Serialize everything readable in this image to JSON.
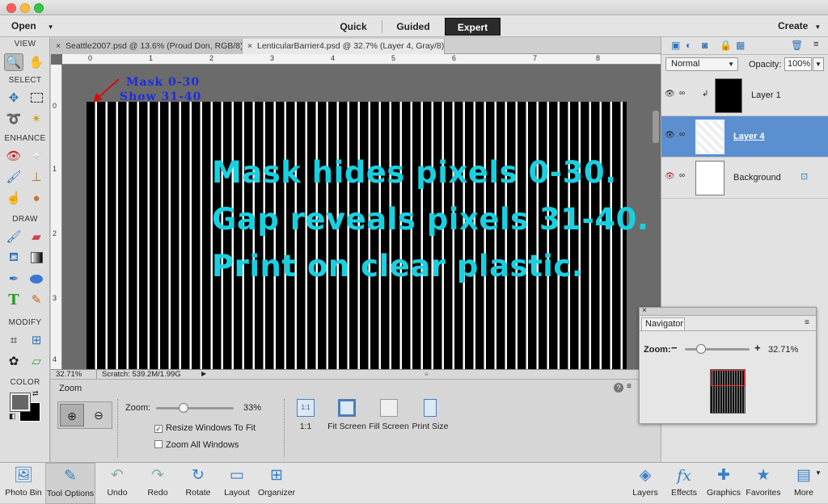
{
  "menu": {
    "open": "Open",
    "create": "Create"
  },
  "modes": [
    {
      "label": "Quick"
    },
    {
      "label": "Guided"
    },
    {
      "label": "Expert"
    }
  ],
  "tools": {
    "sections": {
      "view": "VIEW",
      "select": "SELECT",
      "enhance": "ENHANCE",
      "draw": "DRAW",
      "modify": "MODIFY",
      "color": "COLOR"
    }
  },
  "tabs": [
    {
      "label": "Seattle2007.psd @ 13.6% (Proud Don, RGB/8) *"
    },
    {
      "label": "LenticularBarrier4.psd @ 32.7% (Layer 4, Gray/8)"
    }
  ],
  "ruler": {
    "top": [
      "0",
      "1",
      "2",
      "3",
      "4",
      "5",
      "6",
      "7",
      "8"
    ],
    "left": [
      "0",
      "1",
      "2",
      "3",
      "4"
    ]
  },
  "canvas": {
    "annotation1": "Mask 0-30",
    "annotation2": "Show 31-40",
    "line1": "Mask hides pixels 0-30.",
    "line2": "Gap reveals pixels 31-40.",
    "line3": "Print on clear plastic."
  },
  "status": {
    "zoom": "32.71%",
    "scratch": "Scratch: 539.2M/1.99G"
  },
  "options": {
    "title": "Zoom",
    "zoom_label": "Zoom:",
    "zoom_value": "33%",
    "zoom_fraction": 0.33,
    "resize_windows": "Resize Windows To Fit",
    "zoom_all": "Zoom All Windows",
    "views": [
      {
        "label": "1:1"
      },
      {
        "label": "Fit Screen"
      },
      {
        "label": "Fill Screen"
      },
      {
        "label": "Print Size"
      }
    ],
    "one_to_one_icon": "1:1"
  },
  "layers": {
    "blend_mode": "Normal",
    "opacity_label": "Opacity:",
    "opacity_value": "100%",
    "items": [
      {
        "name": "Layer 1"
      },
      {
        "name": "Layer 4"
      },
      {
        "name": "Background"
      }
    ]
  },
  "navigator": {
    "title": "Navigator",
    "zoom_label": "Zoom:",
    "zoom_value": "32.71%",
    "zoom_fraction": 0.2
  },
  "bottombar": {
    "left": [
      {
        "label": "Photo Bin"
      },
      {
        "label": "Tool Options"
      },
      {
        "label": "Undo"
      },
      {
        "label": "Redo"
      },
      {
        "label": "Rotate"
      },
      {
        "label": "Layout"
      },
      {
        "label": "Organizer"
      }
    ],
    "right": [
      {
        "label": "Layers"
      },
      {
        "label": "Effects"
      },
      {
        "label": "Graphics"
      },
      {
        "label": "Favorites"
      },
      {
        "label": "More"
      }
    ]
  },
  "colors": {
    "accent": "#5b8fd0",
    "text_cyan": "#1ad0e0",
    "text_blue": "#1b2de0"
  }
}
